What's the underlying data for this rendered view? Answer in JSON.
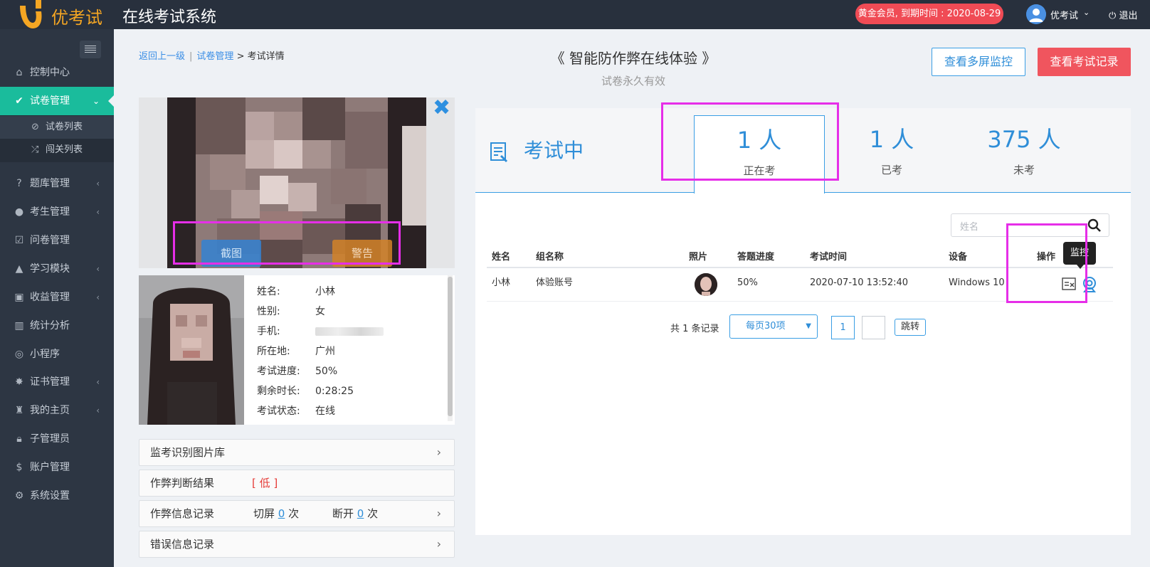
{
  "header": {
    "logo_text": "优考试",
    "system_title": "在线考试系统",
    "membership_badge": "黄金会员, 到期时间 : 2020-08-29",
    "user_name": "优考试",
    "logout_label": "退出",
    "icons": [
      "logo-mark",
      "user-avatar",
      "chevron-down-icon",
      "power-icon"
    ]
  },
  "sidebar": {
    "items": [
      {
        "label": "控制中心",
        "icon": "home-icon"
      },
      {
        "label": "试卷管理",
        "icon": "check-circle-icon",
        "active": true
      },
      {
        "label": "题库管理",
        "icon": "question-icon"
      },
      {
        "label": "考生管理",
        "icon": "user-icon"
      },
      {
        "label": "问卷管理",
        "icon": "checkbox-icon"
      },
      {
        "label": "学习模块",
        "icon": "graduation-icon"
      },
      {
        "label": "收益管理",
        "icon": "money-icon"
      },
      {
        "label": "统计分析",
        "icon": "bar-chart-icon"
      },
      {
        "label": "小程序",
        "icon": "wechat-icon"
      },
      {
        "label": "证书管理",
        "icon": "certificate-icon"
      },
      {
        "label": "我的主页",
        "icon": "home-page-icon"
      },
      {
        "label": "子管理员",
        "icon": "lock-icon"
      },
      {
        "label": "账户管理",
        "icon": "dollar-icon"
      },
      {
        "label": "系统设置",
        "icon": "gear-icon"
      }
    ],
    "subitems": [
      {
        "label": "试卷列表",
        "icon": "check-circle-icon"
      },
      {
        "label": "闯关列表",
        "icon": "shuffle-icon"
      }
    ]
  },
  "breadcrumb": {
    "back": "返回上一级",
    "sep": "|",
    "paper_mgmt": "试卷管理",
    "arrow": ">",
    "current": "考试详情"
  },
  "exam": {
    "title": "《 智能防作弊在线体验 》",
    "subtitle": "试卷永久有效"
  },
  "actions": {
    "multi_monitor": "查看多屏监控",
    "exam_records": "查看考试记录"
  },
  "video": {
    "screenshot_label": "截图",
    "warn_label": "警告"
  },
  "profile": {
    "fields": [
      {
        "key": "姓名:",
        "value": "小林"
      },
      {
        "key": "性别:",
        "value": "女"
      },
      {
        "key": "手机:",
        "value": ""
      },
      {
        "key": "所在地:",
        "value": "广州"
      },
      {
        "key": "考试进度:",
        "value": "50%"
      },
      {
        "key": "剩余时长:",
        "value": "0:28:25"
      },
      {
        "key": "考试状态:",
        "value": "在线"
      }
    ]
  },
  "panels": {
    "image_library": "监考识别图片库",
    "cheat_result_label": "作弊判断结果",
    "cheat_result_value": "[ 低 ]",
    "cheat_info_label": "作弊信息记录",
    "switch_screen_label": "切屏",
    "switch_screen_count": "0",
    "disconnect_label": "断开",
    "disconnect_count": "0",
    "times_unit": "次",
    "error_info_label": "错误信息记录"
  },
  "stats": {
    "status_label": "考试中",
    "tabs": [
      {
        "num": "1 人",
        "caption": "正在考"
      },
      {
        "num": "1 人",
        "caption": "已考"
      },
      {
        "num": "375 人",
        "caption": "未考"
      }
    ]
  },
  "search": {
    "placeholder": "姓名"
  },
  "table": {
    "headers": [
      "姓名",
      "组名称",
      "照片",
      "答题进度",
      "考试时间",
      "设备",
      "操作"
    ],
    "rows": [
      {
        "name": "小林",
        "group": "体验账号",
        "progress": "50%",
        "time": "2020-07-10 13:52:40",
        "device": "Windows 10"
      }
    ],
    "tooltip": "监控"
  },
  "pagination": {
    "total": "共 1 条记录",
    "page_size": "每页30项",
    "current_page": "1",
    "go_label": "跳转"
  },
  "colors": {
    "sidebar_bg": "#2d3643",
    "active_green": "#1abc9c",
    "accent_blue": "#2f8ed8",
    "danger_red": "#f0555e",
    "highlight_magenta": "#e62ee8"
  }
}
